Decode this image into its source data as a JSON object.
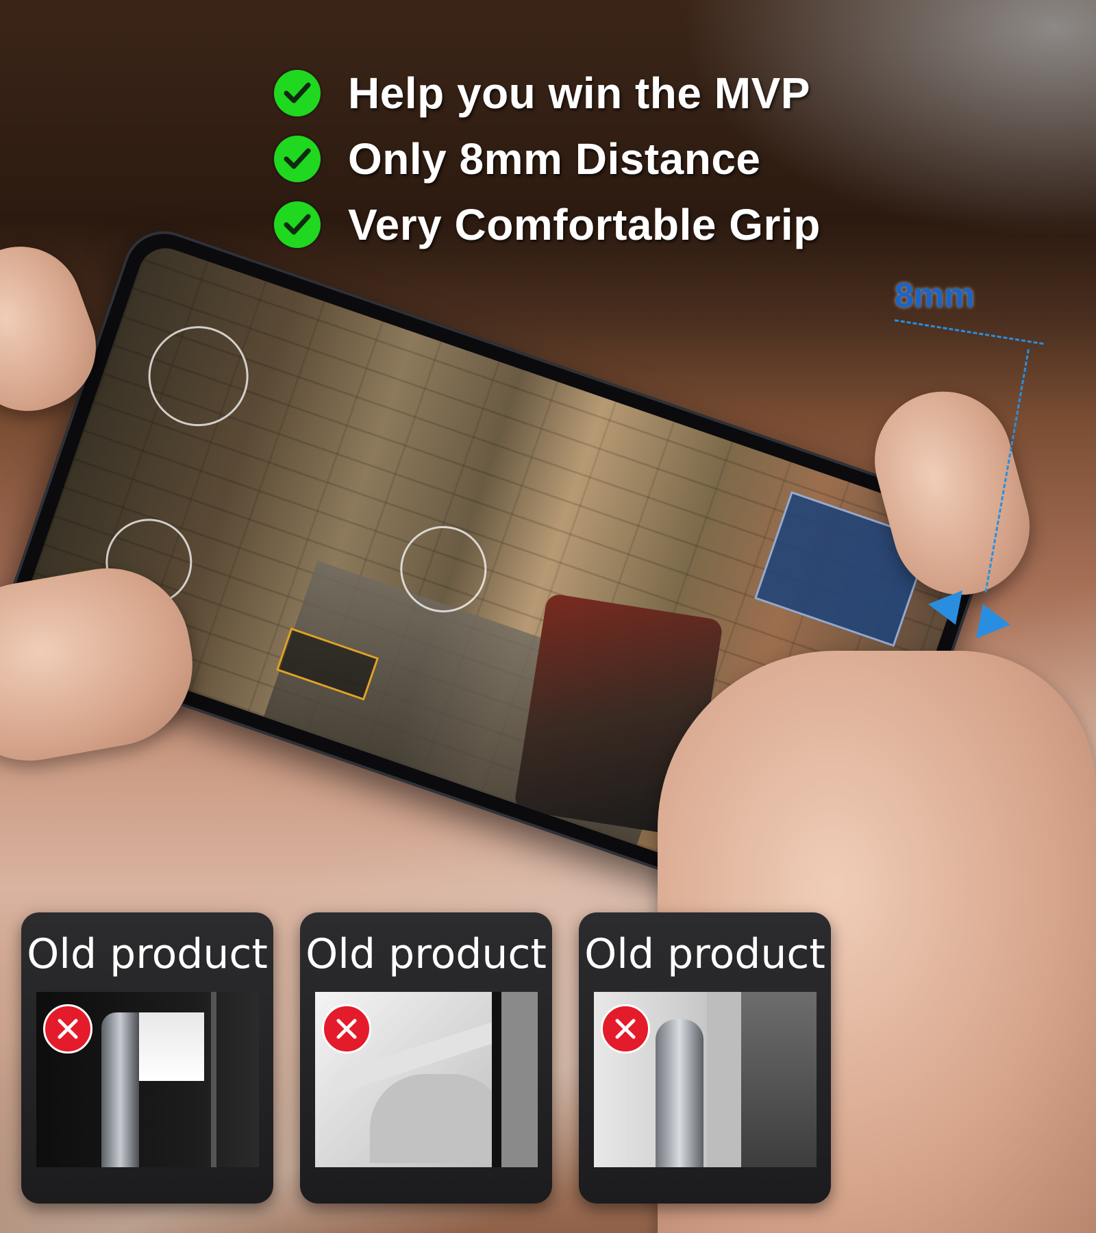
{
  "benefits": [
    {
      "text": "Help you win the MVP",
      "icon": "check-circle-icon"
    },
    {
      "text": "Only 8mm Distance",
      "icon": "check-circle-icon"
    },
    {
      "text": "Very Comfortable Grip",
      "icon": "check-circle-icon"
    }
  ],
  "measurement": {
    "label": "8mm"
  },
  "comparison": [
    {
      "title": "Old product",
      "icon": "x-circle-icon"
    },
    {
      "title": "Old product",
      "icon": "x-circle-icon"
    },
    {
      "title": "Old product",
      "icon": "x-circle-icon"
    }
  ],
  "colors": {
    "check": "#1fd81f",
    "cross": "#e41b2a",
    "measure": "#1a64c8"
  }
}
